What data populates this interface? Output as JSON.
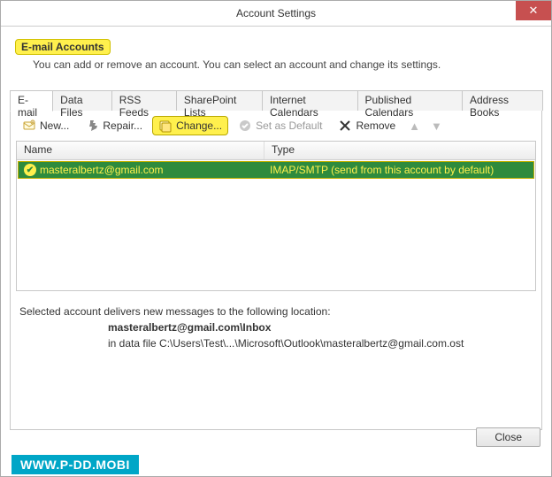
{
  "window": {
    "title": "Account Settings",
    "close_icon": "✕"
  },
  "header": {
    "heading": "E-mail Accounts",
    "description": "You can add or remove an account. You can select an account and change its settings."
  },
  "tabs": {
    "items": [
      "E-mail",
      "Data Files",
      "RSS Feeds",
      "SharePoint Lists",
      "Internet Calendars",
      "Published Calendars",
      "Address Books"
    ],
    "active_index": 0
  },
  "toolbar": {
    "new_label": "New...",
    "repair_label": "Repair...",
    "change_label": "Change...",
    "default_label": "Set as Default",
    "remove_label": "Remove"
  },
  "list": {
    "col_name": "Name",
    "col_type": "Type",
    "rows": [
      {
        "name": "masteralbertz@gmail.com",
        "type": "IMAP/SMTP (send from this account by default)"
      }
    ]
  },
  "delivery": {
    "intro": "Selected account delivers new messages to the following location:",
    "location": "masteralbertz@gmail.com\\Inbox",
    "datafile": "in data file C:\\Users\\Test\\...\\Microsoft\\Outlook\\masteralbertz@gmail.com.ost"
  },
  "footer": {
    "close_label": "Close"
  },
  "watermark": "WWW.P-DD.MOBI"
}
